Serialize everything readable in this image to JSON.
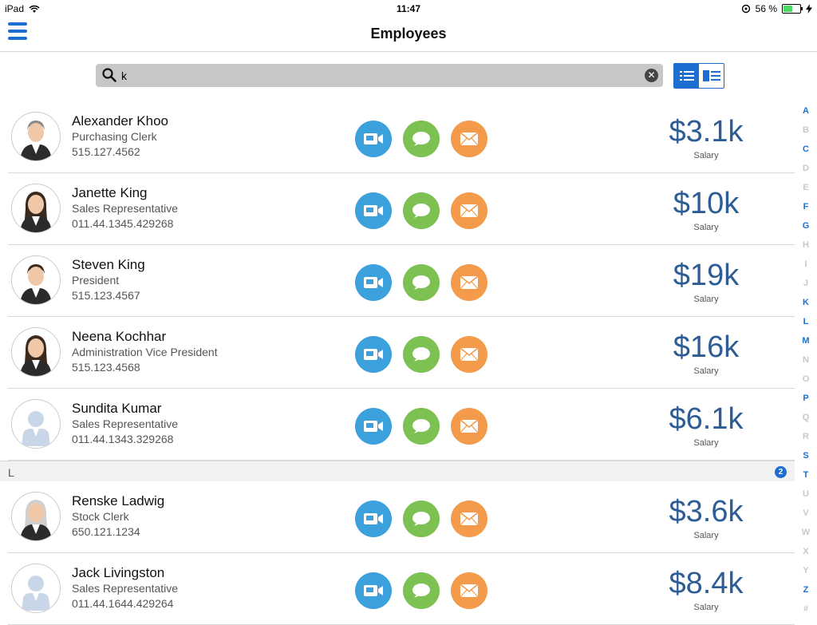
{
  "status": {
    "device": "iPad",
    "time": "11:47",
    "battery": "56 %",
    "battery_level": 0.56
  },
  "nav": {
    "title": "Employees"
  },
  "search": {
    "value": "k",
    "placeholder": ""
  },
  "employees_section1": [
    {
      "name": "Alexander Khoo",
      "title": "Purchasing Clerk",
      "phone": "515.127.4562",
      "salary": "$3.1k",
      "salary_label": "Salary",
      "avatar": "male-suit"
    },
    {
      "name": "Janette King",
      "title": "Sales Representative",
      "phone": "011.44.1345.429268",
      "salary": "$10k",
      "salary_label": "Salary",
      "avatar": "female"
    },
    {
      "name": "Steven King",
      "title": "President",
      "phone": "515.123.4567",
      "salary": "$19k",
      "salary_label": "Salary",
      "avatar": "male"
    },
    {
      "name": "Neena Kochhar",
      "title": "Administration Vice President",
      "phone": "515.123.4568",
      "salary": "$16k",
      "salary_label": "Salary",
      "avatar": "female"
    },
    {
      "name": "Sundita Kumar",
      "title": "Sales Representative",
      "phone": "011.44.1343.329268",
      "salary": "$6.1k",
      "salary_label": "Salary",
      "avatar": "placeholder"
    }
  ],
  "section_L": {
    "letter": "L",
    "count": "2"
  },
  "employees_section2": [
    {
      "name": "Renske Ladwig",
      "title": "Stock Clerk",
      "phone": "650.121.1234",
      "salary": "$3.6k",
      "salary_label": "Salary",
      "avatar": "female-older"
    },
    {
      "name": "Jack Livingston",
      "title": "Sales Representative",
      "phone": "011.44.1644.429264",
      "salary": "$8.4k",
      "salary_label": "Salary",
      "avatar": "placeholder"
    }
  ],
  "index": [
    {
      "l": "A",
      "on": true
    },
    {
      "l": "B",
      "on": false
    },
    {
      "l": "C",
      "on": true
    },
    {
      "l": "D",
      "on": false
    },
    {
      "l": "E",
      "on": false
    },
    {
      "l": "F",
      "on": true
    },
    {
      "l": "G",
      "on": true
    },
    {
      "l": "H",
      "on": false
    },
    {
      "l": "I",
      "on": false
    },
    {
      "l": "J",
      "on": false
    },
    {
      "l": "K",
      "on": true
    },
    {
      "l": "L",
      "on": true
    },
    {
      "l": "M",
      "on": true
    },
    {
      "l": "N",
      "on": false
    },
    {
      "l": "O",
      "on": false
    },
    {
      "l": "P",
      "on": true
    },
    {
      "l": "Q",
      "on": false
    },
    {
      "l": "R",
      "on": false
    },
    {
      "l": "S",
      "on": true
    },
    {
      "l": "T",
      "on": true
    },
    {
      "l": "U",
      "on": false
    },
    {
      "l": "V",
      "on": false
    },
    {
      "l": "W",
      "on": false
    },
    {
      "l": "X",
      "on": false
    },
    {
      "l": "Y",
      "on": false
    },
    {
      "l": "Z",
      "on": true
    },
    {
      "l": "#",
      "on": false
    }
  ],
  "colors": {
    "accent": "#1c6fd0",
    "video": "#3ba0dc",
    "chat": "#7ec153",
    "mail": "#f39b4a",
    "salary": "#2d5d94"
  }
}
